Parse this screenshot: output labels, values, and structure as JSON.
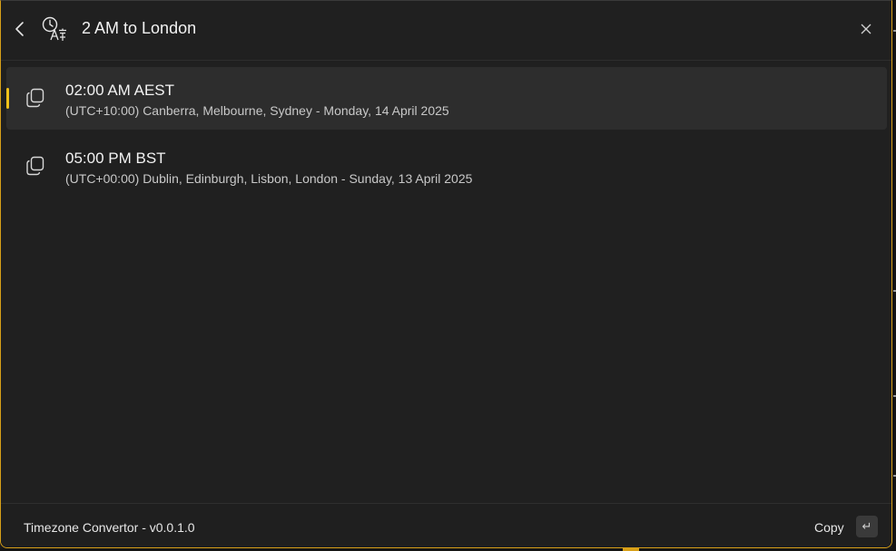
{
  "header": {
    "back_icon": "chevron-left-icon",
    "app_icon": "clock-translate-icon",
    "query": "2 AM to London",
    "close_icon": "close-icon"
  },
  "results": [
    {
      "title": "02:00 AM AEST",
      "subtitle": "(UTC+10:00) Canberra, Melbourne, Sydney - Monday, 14 April 2025",
      "icon": "copy-icon",
      "selected": true
    },
    {
      "title": "05:00 PM BST",
      "subtitle": "(UTC+00:00) Dublin, Edinburgh, Lisbon, London - Sunday, 13 April 2025",
      "icon": "copy-icon",
      "selected": false
    }
  ],
  "footer": {
    "app_name": "Timezone Convertor - v0.0.1.0",
    "primary_action": "Copy",
    "action_key": "↵"
  },
  "colors": {
    "accent": "#f0c11a",
    "window_border": "#d8a018",
    "background": "#202020",
    "selected_row": "#2d2d2d"
  }
}
